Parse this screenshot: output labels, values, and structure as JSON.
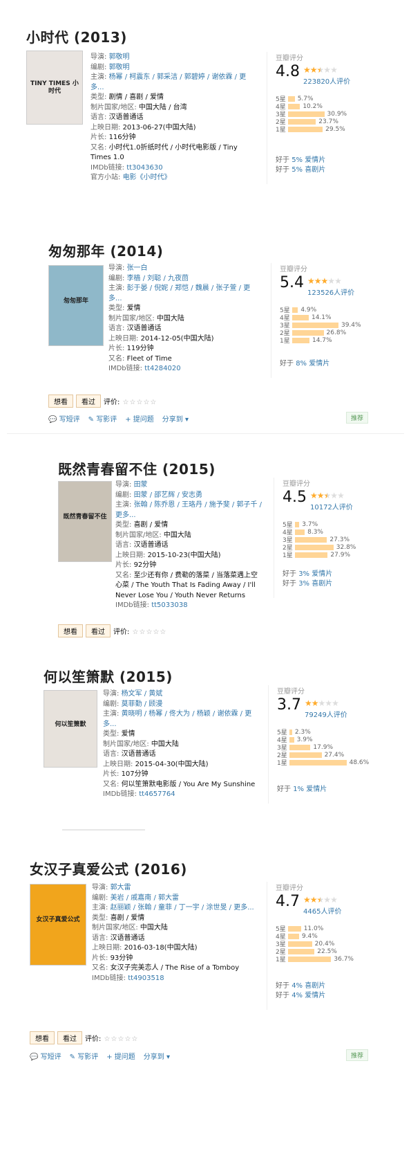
{
  "movies": [
    {
      "title": "小时代 (2013)",
      "poster_bg": "#e9e4e0",
      "poster_text": "TINY TIMES 小时代",
      "info": [
        {
          "label": "导演: ",
          "value": "郭敬明",
          "link": true
        },
        {
          "label": "编剧: ",
          "value": "郭敬明",
          "link": true
        },
        {
          "label": "主演: ",
          "value": "杨幂 / 柯震东 / 郭采洁 / 郭碧婷 / 谢依霖 / 更多...",
          "link": true
        },
        {
          "label": "类型: ",
          "value": "剧情 / 喜剧 / 爱情",
          "link": false
        },
        {
          "label": "制片国家/地区: ",
          "value": "中国大陆 / 台湾",
          "link": false
        },
        {
          "label": "语言: ",
          "value": "汉语普通话",
          "link": false
        },
        {
          "label": "上映日期: ",
          "value": "2013-06-27(中国大陆)",
          "link": false
        },
        {
          "label": "片长: ",
          "value": "116分钟",
          "link": false
        },
        {
          "label": "又名: ",
          "value": "小时代1.0折纸时代 / 小时代电影版 / Tiny Times 1.0",
          "link": false
        },
        {
          "label": "IMDb链接: ",
          "value": "tt3043630",
          "link": true
        },
        {
          "label": "官方小站: ",
          "value": "电影《小时代》",
          "link": true
        }
      ],
      "rating": {
        "head": "豆瓣评分",
        "score": "4.8",
        "stars": 2.5,
        "votes": "223820人评价",
        "dist": [
          {
            "star": "5星",
            "pct": "5.7%",
            "value": 5.7
          },
          {
            "star": "4星",
            "pct": "10.2%",
            "value": 10.2
          },
          {
            "star": "3星",
            "pct": "30.9%",
            "value": 30.9
          },
          {
            "star": "2星",
            "pct": "23.7%",
            "value": 23.7
          },
          {
            "star": "1星",
            "pct": "29.5%",
            "value": 29.5
          }
        ],
        "better": [
          {
            "prefix": "好于 ",
            "pct": "5%",
            "genre": "爱情片"
          },
          {
            "prefix": "好于 ",
            "pct": "5%",
            "genre": "喜剧片"
          }
        ]
      }
    },
    {
      "title": "匆匆那年 (2014)",
      "poster_bg": "#8fb8c9",
      "poster_text": "匆匆那年",
      "info": [
        {
          "label": "导演: ",
          "value": "张一白",
          "link": true
        },
        {
          "label": "编剧: ",
          "value": "李樯 / 刘聪 / 九夜茴",
          "link": true
        },
        {
          "label": "主演: ",
          "value": "彭于晏 / 倪妮 / 郑恺 / 魏晨 / 张子萱 / 更多...",
          "link": true
        },
        {
          "label": "类型: ",
          "value": "爱情",
          "link": false
        },
        {
          "label": "制片国家/地区: ",
          "value": "中国大陆",
          "link": false
        },
        {
          "label": "语言: ",
          "value": "汉语普通话",
          "link": false
        },
        {
          "label": "上映日期: ",
          "value": "2014-12-05(中国大陆)",
          "link": false
        },
        {
          "label": "片长: ",
          "value": "119分钟",
          "link": false
        },
        {
          "label": "又名: ",
          "value": "Fleet of Time",
          "link": false
        },
        {
          "label": "IMDb链接: ",
          "value": "tt4284020",
          "link": true
        }
      ],
      "rating": {
        "head": "豆瓣评分",
        "score": "5.4",
        "stars": 3,
        "votes": "123526人评价",
        "dist": [
          {
            "star": "5星",
            "pct": "4.9%",
            "value": 4.9
          },
          {
            "star": "4星",
            "pct": "14.1%",
            "value": 14.1
          },
          {
            "star": "3星",
            "pct": "39.4%",
            "value": 39.4
          },
          {
            "star": "2星",
            "pct": "26.8%",
            "value": 26.8
          },
          {
            "star": "1星",
            "pct": "14.7%",
            "value": 14.7
          }
        ],
        "better": [
          {
            "prefix": "好于 ",
            "pct": "8%",
            "genre": "爱情片"
          }
        ]
      },
      "actions": {
        "want": "想看",
        "seen": "看过",
        "rate": "评价:",
        "write_short": "写短评",
        "write_review": "写影评",
        "ask": "提问题",
        "share": "分享到 ▾",
        "recommend": "推荐"
      }
    },
    {
      "title": "既然青春留不住 (2015)",
      "poster_bg": "#c9c2b6",
      "poster_text": "既然青春留不住",
      "info": [
        {
          "label": "导演: ",
          "value": "田蒙",
          "link": true
        },
        {
          "label": "编剧: ",
          "value": "田蒙 / 邵艺辉 / 安志勇",
          "link": true
        },
        {
          "label": "主演: ",
          "value": "张翰 / 陈乔恩 / 王珞丹 / 施予斐 / 郭子千 / 更多...",
          "link": true
        },
        {
          "label": "类型: ",
          "value": "喜剧 / 爱情",
          "link": false
        },
        {
          "label": "制片国家/地区: ",
          "value": "中国大陆",
          "link": false
        },
        {
          "label": "语言: ",
          "value": "汉语普通话",
          "link": false
        },
        {
          "label": "上映日期: ",
          "value": "2015-10-23(中国大陆)",
          "link": false
        },
        {
          "label": "片长: ",
          "value": "92分钟",
          "link": false
        },
        {
          "label": "又名: ",
          "value": "至少还有你 / 费勒的落菜 / 当落菜遇上空心菜 / The Youth That Is Fading Away / I'll Never Lose You / Youth Never Returns",
          "link": false
        },
        {
          "label": "IMDb链接: ",
          "value": "tt5033038",
          "link": true
        }
      ],
      "rating": {
        "head": "豆瓣评分",
        "score": "4.5",
        "stars": 2.5,
        "votes": "10172人评价",
        "dist": [
          {
            "star": "5星",
            "pct": "3.7%",
            "value": 3.7
          },
          {
            "star": "4星",
            "pct": "8.3%",
            "value": 8.3
          },
          {
            "star": "3星",
            "pct": "27.3%",
            "value": 27.3
          },
          {
            "star": "2星",
            "pct": "32.8%",
            "value": 32.8
          },
          {
            "star": "1星",
            "pct": "27.9%",
            "value": 27.9
          }
        ],
        "better": [
          {
            "prefix": "好于 ",
            "pct": "3%",
            "genre": "爱情片"
          },
          {
            "prefix": "好于 ",
            "pct": "3%",
            "genre": "喜剧片"
          }
        ]
      },
      "actions": {
        "want": "想看",
        "seen": "看过",
        "rate": "评价:"
      }
    },
    {
      "title": "何以笙箫默 (2015)",
      "poster_bg": "#e7e2dc",
      "poster_text": "何以笙箫默",
      "info": [
        {
          "label": "导演: ",
          "value": "杨文军 / 黄斌",
          "link": true
        },
        {
          "label": "编剧: ",
          "value": "莫菲勤 / 顾漫",
          "link": true
        },
        {
          "label": "主演: ",
          "value": "黄晓明 / 杨幂 / 佟大为 / 杨颖 / 谢依霖 / 更多...",
          "link": true
        },
        {
          "label": "类型: ",
          "value": "爱情",
          "link": false
        },
        {
          "label": "制片国家/地区: ",
          "value": "中国大陆",
          "link": false
        },
        {
          "label": "语言: ",
          "value": "汉语普通话",
          "link": false
        },
        {
          "label": "上映日期: ",
          "value": "2015-04-30(中国大陆)",
          "link": false
        },
        {
          "label": "片长: ",
          "value": "107分钟",
          "link": false
        },
        {
          "label": "又名: ",
          "value": "何以笙箫默电影版 / You Are My Sunshine",
          "link": false
        },
        {
          "label": "IMDb链接: ",
          "value": "tt4657764",
          "link": true
        }
      ],
      "rating": {
        "head": "豆瓣评分",
        "score": "3.7",
        "stars": 2,
        "votes": "79249人评价",
        "dist": [
          {
            "star": "5星",
            "pct": "2.3%",
            "value": 2.3
          },
          {
            "star": "4星",
            "pct": "3.9%",
            "value": 3.9
          },
          {
            "star": "3星",
            "pct": "17.9%",
            "value": 17.9
          },
          {
            "star": "2星",
            "pct": "27.4%",
            "value": 27.4
          },
          {
            "star": "1星",
            "pct": "48.6%",
            "value": 48.6
          }
        ],
        "better": [
          {
            "prefix": "好于 ",
            "pct": "1%",
            "genre": "爱情片"
          }
        ]
      }
    },
    {
      "title": "女汉子真爱公式 (2016)",
      "poster_bg": "#f1a51c",
      "poster_text": "女汉子真爱公式",
      "info": [
        {
          "label": "导演: ",
          "value": "郭大雷",
          "link": true
        },
        {
          "label": "编剧: ",
          "value": "美岩 / 戚嘉南 / 郭大雷",
          "link": true
        },
        {
          "label": "主演: ",
          "value": "赵丽颖 / 张翰 / 童菲 / 丁一宇 / 涂世旻 / 更多...",
          "link": true
        },
        {
          "label": "类型: ",
          "value": "喜剧 / 爱情",
          "link": false
        },
        {
          "label": "制片国家/地区: ",
          "value": "中国大陆",
          "link": false
        },
        {
          "label": "语言: ",
          "value": "汉语普通话",
          "link": false
        },
        {
          "label": "上映日期: ",
          "value": "2016-03-18(中国大陆)",
          "link": false
        },
        {
          "label": "片长: ",
          "value": "93分钟",
          "link": false
        },
        {
          "label": "又名: ",
          "value": "女汉子完美恋人 / The Rise of a Tomboy",
          "link": false
        },
        {
          "label": "IMDb链接: ",
          "value": "tt4903518",
          "link": true
        }
      ],
      "rating": {
        "head": "豆瓣评分",
        "score": "4.7",
        "stars": 2.5,
        "votes": "4465人评价",
        "dist": [
          {
            "star": "5星",
            "pct": "11.0%",
            "value": 11.0
          },
          {
            "star": "4星",
            "pct": "9.4%",
            "value": 9.4
          },
          {
            "star": "3星",
            "pct": "20.4%",
            "value": 20.4
          },
          {
            "star": "2星",
            "pct": "22.5%",
            "value": 22.5
          },
          {
            "star": "1星",
            "pct": "36.7%",
            "value": 36.7
          }
        ],
        "better": [
          {
            "prefix": "好于 ",
            "pct": "4%",
            "genre": "喜剧片"
          },
          {
            "prefix": "好于 ",
            "pct": "4%",
            "genre": "爱情片"
          }
        ]
      },
      "actions": {
        "want": "想看",
        "seen": "看过",
        "rate": "评价:",
        "write_short": "写短评",
        "write_review": "写影评",
        "ask": "提问题",
        "share": "分享到 ▾",
        "recommend": "推荐"
      }
    }
  ],
  "icons": {
    "star_full": "star-icon",
    "comment": "comment-icon",
    "pen": "pen-icon",
    "plus": "plus-icon"
  },
  "colors": {
    "link": "#3377aa",
    "bar": "#ffd596",
    "star": "#ffac2d",
    "button_bg": "#fff5e6"
  }
}
